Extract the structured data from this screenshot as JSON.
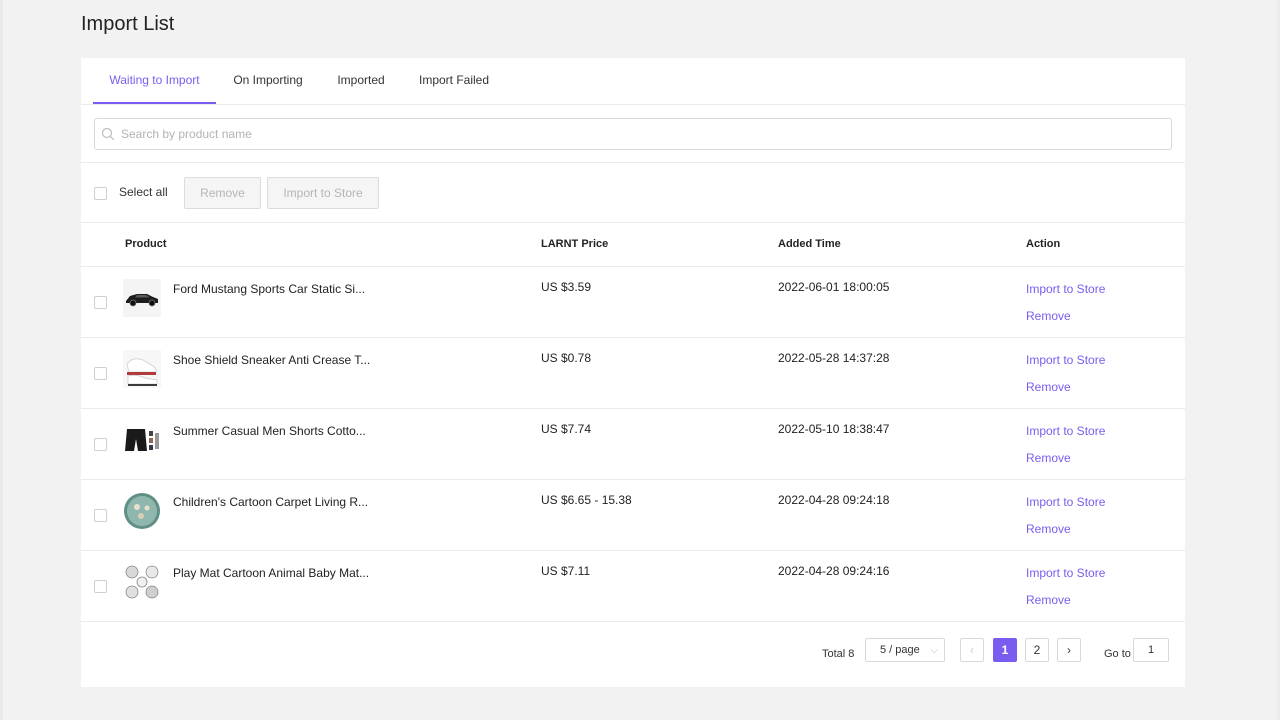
{
  "page": {
    "title": "Import List"
  },
  "tabs": [
    {
      "label": "Waiting to Import",
      "active": true
    },
    {
      "label": "On Importing",
      "active": false
    },
    {
      "label": "Imported",
      "active": false
    },
    {
      "label": "Import Failed",
      "active": false
    }
  ],
  "search": {
    "placeholder": "Search by product name",
    "icon": "search-icon"
  },
  "bulk": {
    "select_all": "Select all",
    "remove": "Remove",
    "import": "Import to Store"
  },
  "table": {
    "headers": {
      "product": "Product",
      "price": "LARNT Price",
      "added": "Added Time",
      "action": "Action"
    },
    "rows": [
      {
        "name": "Ford Mustang Sports Car Static Si...",
        "price": "US $3.59",
        "time": "2022-06-01 18:00:05",
        "import": "Import to Store",
        "remove": "Remove"
      },
      {
        "name": "Shoe Shield Sneaker Anti Crease T...",
        "price": "US $0.78",
        "time": "2022-05-28 14:37:28",
        "import": "Import to Store",
        "remove": "Remove"
      },
      {
        "name": "Summer Casual Men Shorts Cotto...",
        "price": "US $7.74",
        "time": "2022-05-10 18:38:47",
        "import": "Import to Store",
        "remove": "Remove"
      },
      {
        "name": "Children's Cartoon Carpet Living R...",
        "price": "US $6.65 - 15.38",
        "time": "2022-04-28 09:24:18",
        "import": "Import to Store",
        "remove": "Remove"
      },
      {
        "name": "Play Mat Cartoon Animal Baby Mat...",
        "price": "US $7.11",
        "time": "2022-04-28 09:24:16",
        "import": "Import to Store",
        "remove": "Remove"
      }
    ]
  },
  "pagination": {
    "total": "Total 8",
    "page_size": "5 / page",
    "pages": [
      "1",
      "2"
    ],
    "current": "1",
    "goto_label": "Go to",
    "goto_value": "1",
    "prev": "‹",
    "next": "›"
  },
  "colors": {
    "accent": "#7b5cf0"
  }
}
